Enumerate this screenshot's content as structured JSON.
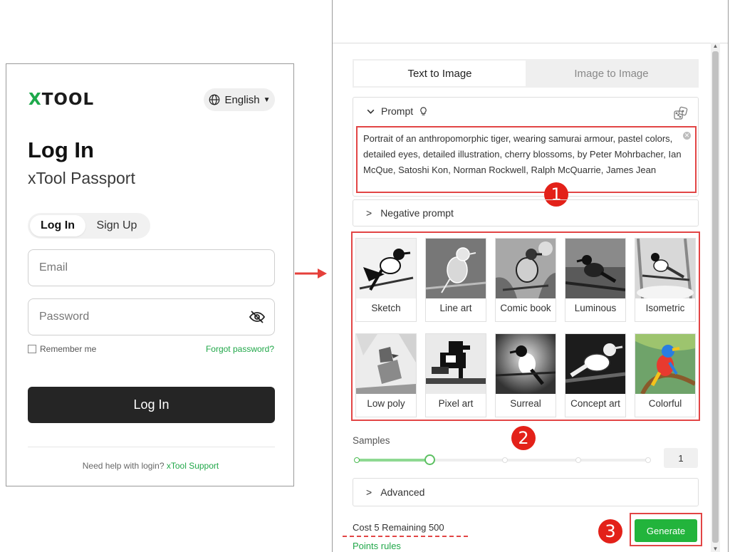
{
  "login": {
    "logo": {
      "x": "X",
      "rest": "TOOL"
    },
    "language": "English",
    "title": "Log In",
    "subtitle": "xTool Passport",
    "tabs": [
      "Log In",
      "Sign Up"
    ],
    "email_placeholder": "Email",
    "password_placeholder": "Password",
    "remember_me": "Remember me",
    "forgot_password": "Forgot password?",
    "login_button": "Log In",
    "help_text": "Need help with login?",
    "support_link": "xTool Support"
  },
  "generator": {
    "tabs": [
      "Text to Image",
      "Image to Image"
    ],
    "prompt_label": "Prompt",
    "prompt_text": "Portrait of an anthropomorphic tiger, wearing samurai armour, pastel colors, detailed eyes, detailed illustration, cherry blossoms, by Peter Mohrbacher, Ian McQue, Satoshi Kon, Norman Rockwell, Ralph McQuarrie, James Jean",
    "negative_prompt_label": "Negative prompt",
    "styles": [
      "Sketch",
      "Line art",
      "Comic book",
      "Luminous",
      "Isometric",
      "Low poly",
      "Pixel art",
      "Surreal",
      "Concept art",
      "Colorful"
    ],
    "samples_label": "Samples",
    "samples_value": "1",
    "advanced_label": "Advanced",
    "cost_text": "Cost 5 Remaining 500",
    "points_rules": "Points rules",
    "generate_button": "Generate"
  },
  "annotations": [
    "1",
    "2",
    "3"
  ],
  "colors": {
    "brand_green": "#1ea94b",
    "link_green": "#21a749",
    "generate_green": "#22b43c",
    "highlight_red": "#e24545",
    "badge_red": "#e32119",
    "dark_button": "#252525"
  },
  "icons": {
    "language": "globe-icon",
    "password_toggle": "eye-off-icon",
    "prompt_collapse": "chevron-down-icon",
    "prompt_hint": "lightbulb-icon",
    "random_prompt": "dice-icon",
    "clear": "close-icon",
    "expand": "chevron-right-icon"
  }
}
